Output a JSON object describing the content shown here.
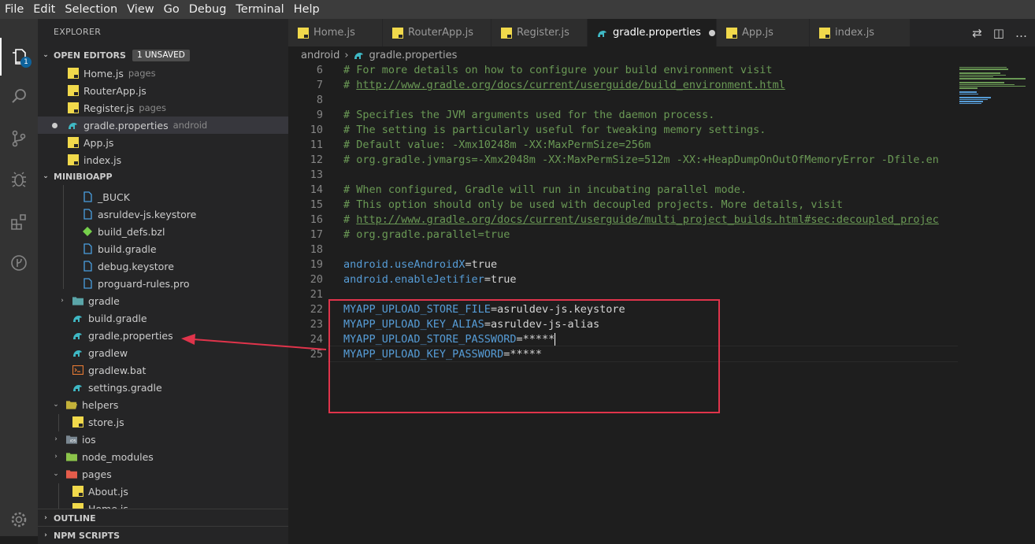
{
  "menu": [
    "File",
    "Edit",
    "Selection",
    "View",
    "Go",
    "Debug",
    "Terminal",
    "Help"
  ],
  "activity_badge": "1",
  "sidebar": {
    "title": "EXPLORER",
    "open_editors_label": "OPEN EDITORS",
    "unsaved_label": "1 UNSAVED",
    "open_editors": [
      {
        "name": "Home.js",
        "desc": "pages",
        "icon": "js"
      },
      {
        "name": "RouterApp.js",
        "desc": "",
        "icon": "js"
      },
      {
        "name": "Register.js",
        "desc": "pages",
        "icon": "js"
      },
      {
        "name": "gradle.properties",
        "desc": "android",
        "icon": "gradle"
      },
      {
        "name": "App.js",
        "desc": "",
        "icon": "js"
      },
      {
        "name": "index.js",
        "desc": "",
        "icon": "js"
      }
    ],
    "project_label": "MINIBIOAPP",
    "tree": [
      {
        "name": "_BUCK",
        "icon": "file",
        "indent": 2
      },
      {
        "name": "asruldev-js.keystore",
        "icon": "file",
        "indent": 2
      },
      {
        "name": "build_defs.bzl",
        "icon": "bzl",
        "indent": 2
      },
      {
        "name": "build.gradle",
        "icon": "file",
        "indent": 2
      },
      {
        "name": "debug.keystore",
        "icon": "file",
        "indent": 2
      },
      {
        "name": "proguard-rules.pro",
        "icon": "file",
        "indent": 2
      },
      {
        "name": "gradle",
        "icon": "folder-gradle",
        "indent": 1,
        "twisty": "›"
      },
      {
        "name": "build.gradle",
        "icon": "gradle",
        "indent": 1
      },
      {
        "name": "gradle.properties",
        "icon": "gradle",
        "indent": 1
      },
      {
        "name": "gradlew",
        "icon": "gradle",
        "indent": 1
      },
      {
        "name": "gradlew.bat",
        "icon": "bat",
        "indent": 1
      },
      {
        "name": "settings.gradle",
        "icon": "gradle",
        "indent": 1
      },
      {
        "name": "helpers",
        "icon": "folder-open",
        "indent": 0,
        "twisty": "⌄"
      },
      {
        "name": "store.js",
        "icon": "js",
        "indent": 1
      },
      {
        "name": "ios",
        "icon": "folder-ios",
        "indent": 0,
        "twisty": "›"
      },
      {
        "name": "node_modules",
        "icon": "folder-node",
        "indent": 0,
        "twisty": "›"
      },
      {
        "name": "pages",
        "icon": "folder-pages",
        "indent": 0,
        "twisty": "⌄"
      },
      {
        "name": "About.js",
        "icon": "js",
        "indent": 1
      },
      {
        "name": "Home.js",
        "icon": "js",
        "indent": 1
      }
    ],
    "outline_label": "OUTLINE",
    "npm_label": "NPM SCRIPTS"
  },
  "tabs": [
    {
      "name": "Home.js",
      "icon": "js",
      "active": false
    },
    {
      "name": "RouterApp.js",
      "icon": "js",
      "active": false
    },
    {
      "name": "Register.js",
      "icon": "js",
      "active": false
    },
    {
      "name": "gradle.properties",
      "icon": "gradle",
      "active": true,
      "modified": true
    },
    {
      "name": "App.js",
      "icon": "js",
      "active": false
    },
    {
      "name": "index.js",
      "icon": "js",
      "active": false
    }
  ],
  "breadcrumb": {
    "folder": "android",
    "file": "gradle.properties"
  },
  "code_lines": [
    {
      "n": "6",
      "t": "# For more details on how to configure your build environment visit",
      "k": "c"
    },
    {
      "n": "7",
      "t": "# http://www.gradle.org/docs/current/userguide/build_environment.html",
      "k": "u"
    },
    {
      "n": "8",
      "t": "",
      "k": "c"
    },
    {
      "n": "9",
      "t": "# Specifies the JVM arguments used for the daemon process.",
      "k": "c"
    },
    {
      "n": "10",
      "t": "# The setting is particularly useful for tweaking memory settings.",
      "k": "c"
    },
    {
      "n": "11",
      "t": "# Default value: -Xmx10248m -XX:MaxPermSize=256m",
      "k": "c"
    },
    {
      "n": "12",
      "t": "# org.gradle.jvmargs=-Xmx2048m -XX:MaxPermSize=512m -XX:+HeapDumpOnOutOfMemoryError -Dfile.en",
      "k": "c"
    },
    {
      "n": "13",
      "t": "",
      "k": "c"
    },
    {
      "n": "14",
      "t": "# When configured, Gradle will run in incubating parallel mode.",
      "k": "c"
    },
    {
      "n": "15",
      "t": "# This option should only be used with decoupled projects. More details, visit",
      "k": "c"
    },
    {
      "n": "16",
      "t": "# http://www.gradle.org/docs/current/userguide/multi_project_builds.html#sec:decoupled_projec",
      "k": "u"
    },
    {
      "n": "17",
      "t": "# org.gradle.parallel=true",
      "k": "c"
    },
    {
      "n": "18",
      "t": "",
      "k": "c"
    },
    {
      "n": "19",
      "t": "android.useAndroidX=true",
      "k": "p"
    },
    {
      "n": "20",
      "t": "android.enableJetifier=true",
      "k": "p"
    },
    {
      "n": "21",
      "t": "",
      "k": "c"
    },
    {
      "n": "22",
      "t": "MYAPP_UPLOAD_STORE_FILE=asruldev-js.keystore",
      "k": "p"
    },
    {
      "n": "23",
      "t": "MYAPP_UPLOAD_KEY_ALIAS=asruldev-js-alias",
      "k": "p"
    },
    {
      "n": "24",
      "t": "MYAPP_UPLOAD_STORE_PASSWORD=*****",
      "k": "p"
    },
    {
      "n": "25",
      "t": "MYAPP_UPLOAD_KEY_PASSWORD=*****",
      "k": "p"
    }
  ],
  "colors": {
    "highlight": "#e0344b",
    "accent": "#0e639c"
  }
}
